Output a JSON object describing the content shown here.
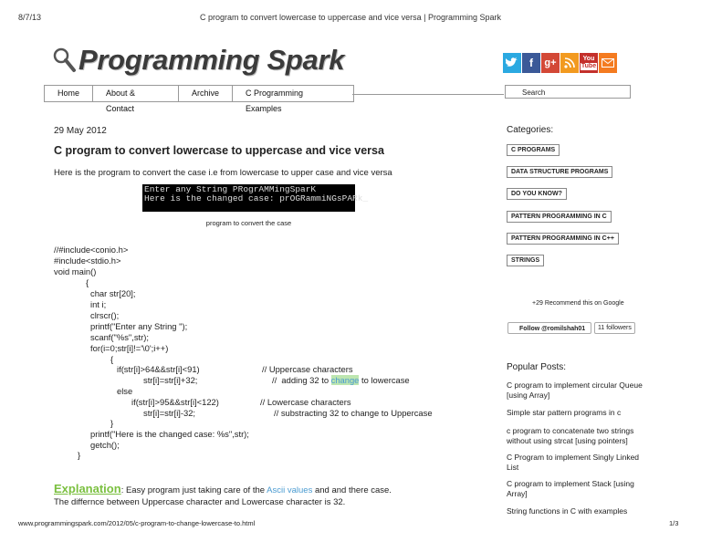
{
  "print_header": {
    "date": "8/7/13",
    "title": "C program to convert lowercase to uppercase and vice versa | Programming Spark"
  },
  "logo": {
    "text": "Programming Spark",
    "icon": "magnifier-icon"
  },
  "social": [
    {
      "name": "twitter",
      "glyph": "🐦",
      "color": "#2ba9e1"
    },
    {
      "name": "facebook",
      "glyph": "f",
      "color": "#3b5998"
    },
    {
      "name": "google-plus",
      "glyph": "g+",
      "color": "#d34836"
    },
    {
      "name": "rss",
      "glyph": "⌁",
      "color": "#f29a1f"
    },
    {
      "name": "youtube",
      "glyph": "You",
      "color": "#c4302b"
    },
    {
      "name": "email",
      "glyph": "✉",
      "color": "#f47b20"
    }
  ],
  "nav": [
    "Home",
    "About & Contact",
    "Archive",
    "C Programming Examples"
  ],
  "search": {
    "placeholder": "Search"
  },
  "post": {
    "date": "29 May 2012",
    "title": "C program to convert lowercase to uppercase and vice versa",
    "intro": "Here is the program to convert the case i.e from lowercase to upper case and vice versa",
    "console": "Enter any String PRogrAMMingSparK\nHere is the changed case: prOGRammiNGsPARk_",
    "caption": "program to convert the case",
    "code": {
      "l1": "//#include<conio.h>",
      "l2": "#include<stdio.h>",
      "l3": "void main()",
      "l4": "{",
      "l5": "char str[20];",
      "l6": "int i;",
      "l7": "clrscr();",
      "l8": "printf(\"Enter any String \");",
      "l9": "scanf(\"%s\",str);",
      "l10": "for(i=0;str[i]!='\\0';i++)",
      "l11": "{",
      "l12": "if(str[i]>64&&str[i]<91)",
      "c12": "// Uppercase characters",
      "l13": "str[i]=str[i]+32;",
      "c13a": "//  adding 32 to ",
      "c13b": "change",
      "c13c": " to lowercase",
      "l14": "else",
      "l15": "if(str[i]>95&&str[i]<122)",
      "c15": "// Lowercase characters",
      "l16": "str[i]=str[i]-32;",
      "c16": "// substracting 32 to change to Uppercase",
      "l17": "}",
      "l18": "printf(\"Here is the changed case: %s\",str);",
      "l19": "getch();",
      "l20": "}"
    },
    "explanation": {
      "heading": "Explanation",
      "t1": ": Easy program just taking care of the ",
      "link": "Ascii values",
      "t2": " and and there case.",
      "line2": "The differnce between Uppercase character and Lowercase character is 32."
    }
  },
  "sidebar": {
    "categories_title": "Categories:",
    "categories": [
      "C PROGRAMS",
      "DATA STRUCTURE PROGRAMS",
      "DO YOU KNOW?",
      "PATTERN PROGRAMMING IN C",
      "PATTERN PROGRAMMING IN C++",
      "STRINGS"
    ],
    "gplus": "+29   Recommend this on Google",
    "follow": "Follow @romilshah01",
    "followers": "11 followers",
    "popular_title": "Popular Posts:",
    "popular": [
      "C program to implement circular Queue [using Array]",
      "Simple star pattern programs in c",
      "c program to concatenate two strings without using strcat [using pointers]",
      "C Program to implement Singly Linked List",
      "C program to implement Stack [using Array]",
      "String functions in C with examples"
    ]
  },
  "footer": {
    "url": "www.programmingspark.com/2012/05/c-program-to-change-lowercase-to.html",
    "page": "1/3"
  }
}
